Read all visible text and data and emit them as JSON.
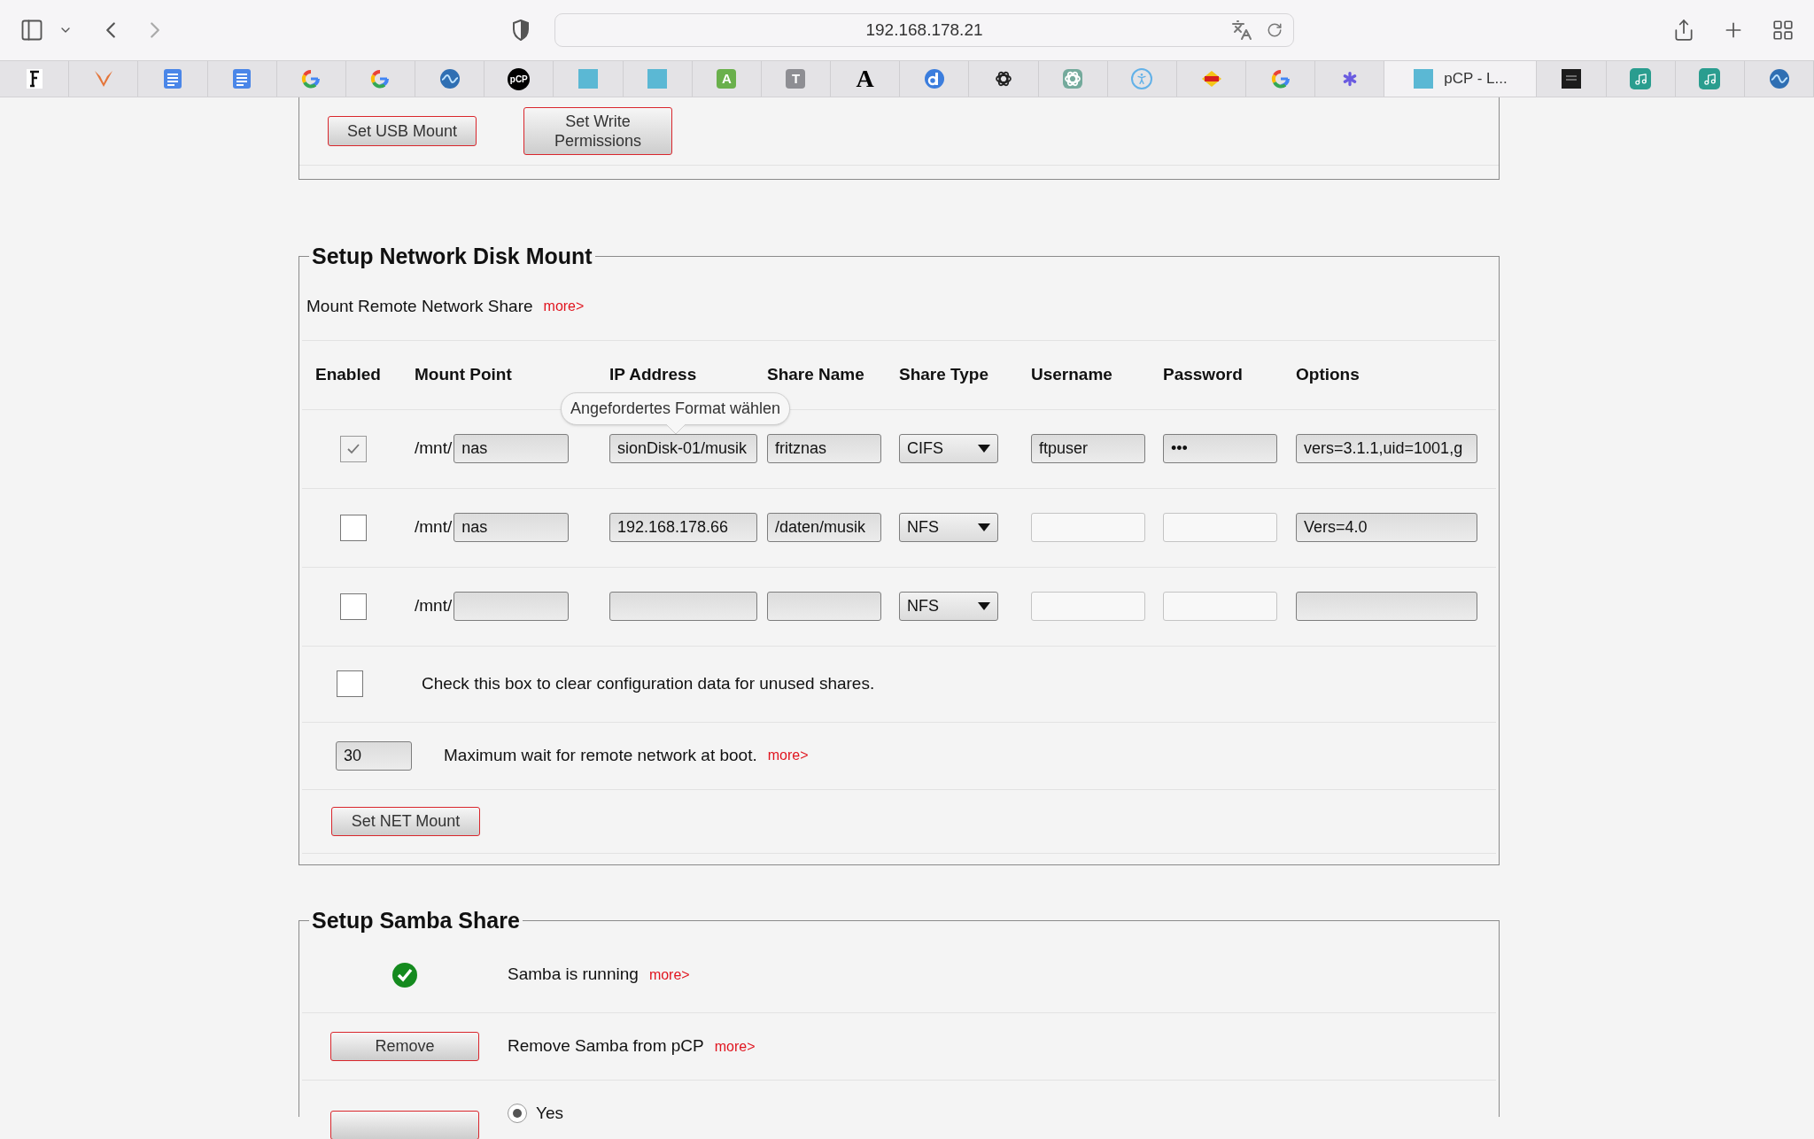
{
  "browser": {
    "address": "192.168.178.21",
    "tabs": [
      {
        "kind": "fraktur",
        "selected": false
      },
      {
        "kind": "bird",
        "selected": false
      },
      {
        "kind": "doc",
        "selected": false
      },
      {
        "kind": "doc",
        "selected": false
      },
      {
        "kind": "google",
        "selected": false
      },
      {
        "kind": "google",
        "selected": false
      },
      {
        "kind": "wave",
        "selected": false
      },
      {
        "kind": "badge",
        "glyph": "pCP",
        "color": "#000000",
        "selected": false
      },
      {
        "kind": "square",
        "color": "#5bb8d4",
        "selected": false
      },
      {
        "kind": "square",
        "color": "#5bb8d4",
        "selected": false
      },
      {
        "kind": "tile",
        "glyph": "A",
        "color": "#6ab04c",
        "selected": false
      },
      {
        "kind": "tile",
        "glyph": "T",
        "color": "#8e8e93",
        "selected": false
      },
      {
        "kind": "letter",
        "glyph": "A",
        "selected": false
      },
      {
        "kind": "info",
        "selected": false
      },
      {
        "kind": "knot",
        "color": "#222222",
        "selected": false
      },
      {
        "kind": "knot",
        "color": "#74aa9c",
        "selected": false
      },
      {
        "kind": "person",
        "selected": false
      },
      {
        "kind": "fritz",
        "selected": false
      },
      {
        "kind": "google",
        "selected": false
      },
      {
        "kind": "sparkle",
        "selected": false
      },
      {
        "kind": "square",
        "color": "#5bb8d4",
        "label": "pCP - L...",
        "selected": true
      },
      {
        "kind": "dark",
        "selected": false
      },
      {
        "kind": "music",
        "selected": false
      },
      {
        "kind": "music",
        "selected": false
      },
      {
        "kind": "wave",
        "selected": false
      }
    ]
  },
  "usb": {
    "buttons": [
      "Set USB Mount",
      "Set Write Permissions"
    ]
  },
  "network": {
    "legend": "Setup Network Disk Mount",
    "intro": "Mount Remote Network Share",
    "intro_more": "more>",
    "columns": [
      "Enabled",
      "Mount Point",
      "IP Address",
      "Share Name",
      "Share Type",
      "Username",
      "Password",
      "Options"
    ],
    "tooltip": "Angefordertes Format wählen",
    "rows": [
      {
        "enabled": true,
        "prefix": "/mnt/",
        "mount_point": "nas",
        "ip_address": "sionDisk-01/musik",
        "share_name": "fritznas",
        "share_type": "CIFS",
        "username": {
          "value": "ftpuser",
          "disabled": false
        },
        "password": {
          "value": "•••",
          "disabled": false
        },
        "options": "vers=3.1.1,uid=1001,g"
      },
      {
        "enabled": false,
        "prefix": "/mnt/",
        "mount_point": "nas",
        "ip_address": "192.168.178.66",
        "share_name": "/daten/musik",
        "share_type": "NFS",
        "username": {
          "disabled": true
        },
        "password": {
          "disabled": true
        },
        "options": "Vers=4.0"
      },
      {
        "enabled": false,
        "prefix": "/mnt/",
        "share_type": "NFS",
        "username": {
          "disabled": true
        },
        "password": {
          "disabled": true
        }
      }
    ],
    "clear": {
      "checked": false,
      "text": "Check this box to clear configuration data for unused shares."
    },
    "wait": {
      "value": "30",
      "text": "Maximum wait for remote network at boot.",
      "more": "more>"
    },
    "button": "Set NET Mount"
  },
  "samba": {
    "legend": "Setup Samba Share",
    "status": {
      "running": true,
      "text": "Samba is running",
      "more": "more>"
    },
    "remove": {
      "button": "Remove",
      "text": "Remove Samba from pCP",
      "more": "more>"
    },
    "option": {
      "label": "Yes",
      "selected": true
    }
  }
}
